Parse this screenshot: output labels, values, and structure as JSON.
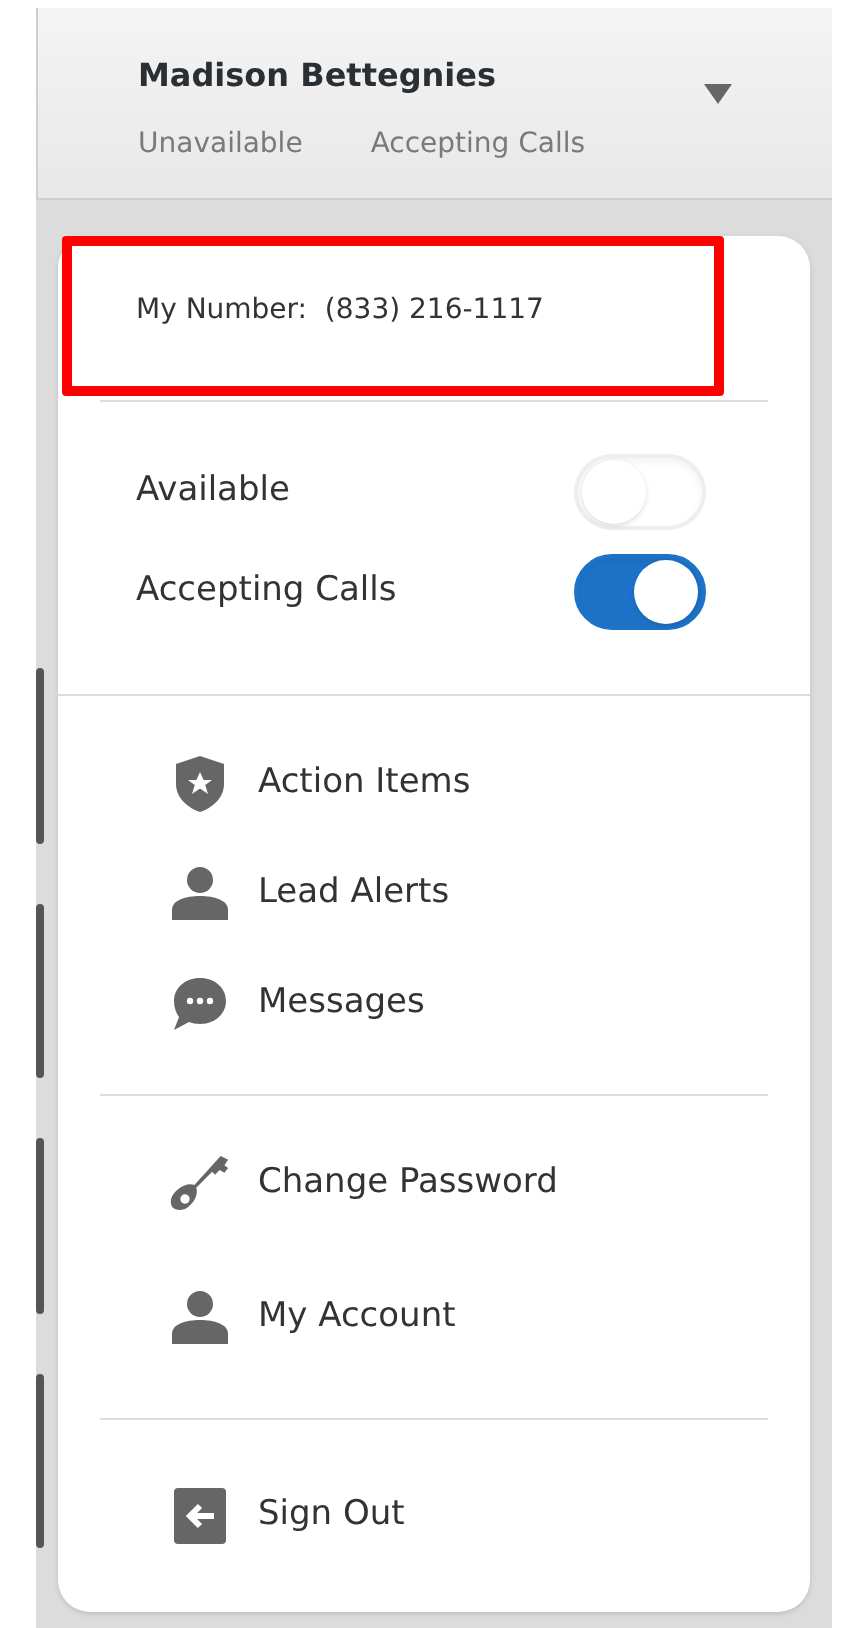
{
  "header": {
    "name": "Madison Bettegnies",
    "status": "Unavailable",
    "calls": "Accepting Calls"
  },
  "my_number": {
    "label": "My Number:",
    "value": "(833) 216-1117",
    "highlighted": true
  },
  "toggles": [
    {
      "label": "Available",
      "on": false
    },
    {
      "label": "Accepting Calls",
      "on": true
    }
  ],
  "menu_groups": [
    {
      "items": [
        {
          "kind": "shield",
          "label": "Action Items"
        },
        {
          "kind": "person",
          "label": "Lead Alerts"
        },
        {
          "kind": "chat",
          "label": "Messages"
        }
      ]
    },
    {
      "items": [
        {
          "kind": "key",
          "label": "Change Password"
        },
        {
          "kind": "person",
          "label": "My Account"
        }
      ]
    },
    {
      "items": [
        {
          "kind": "exit",
          "label": "Sign Out"
        }
      ]
    }
  ]
}
